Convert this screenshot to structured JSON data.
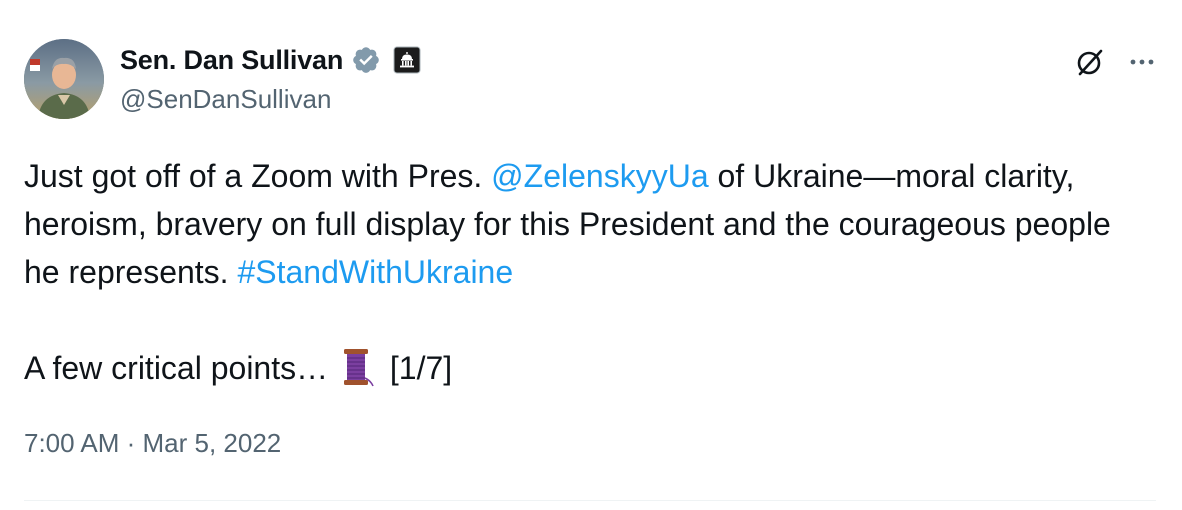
{
  "author": {
    "display_name": "Sen. Dan Sullivan",
    "handle": "@SenDanSullivan",
    "verified": true,
    "gov_affiliation_badge": "capitol-building-icon"
  },
  "actions": {
    "grok_icon": "grok-slash-circle-icon",
    "more_icon": "more-dots-icon"
  },
  "tweet": {
    "line1_prefix": "Just got off of a Zoom with Pres. ",
    "mention": "@ZelenskyyUa",
    "line1_suffix": " of Ukraine—moral clarity, heroism, bravery on full display for this President and the courageous people he represents. ",
    "hashtag": "#StandWithUkraine",
    "line2_prefix": "A few critical points… ",
    "thread_emoji": "spool-of-thread-emoji",
    "line2_suffix": " [1/7]"
  },
  "meta": {
    "timestamp": "7:00 AM · Mar 5, 2022"
  },
  "colors": {
    "link": "#1d9bf0",
    "secondary_text": "#536471",
    "verified_badge": "#829aab"
  }
}
